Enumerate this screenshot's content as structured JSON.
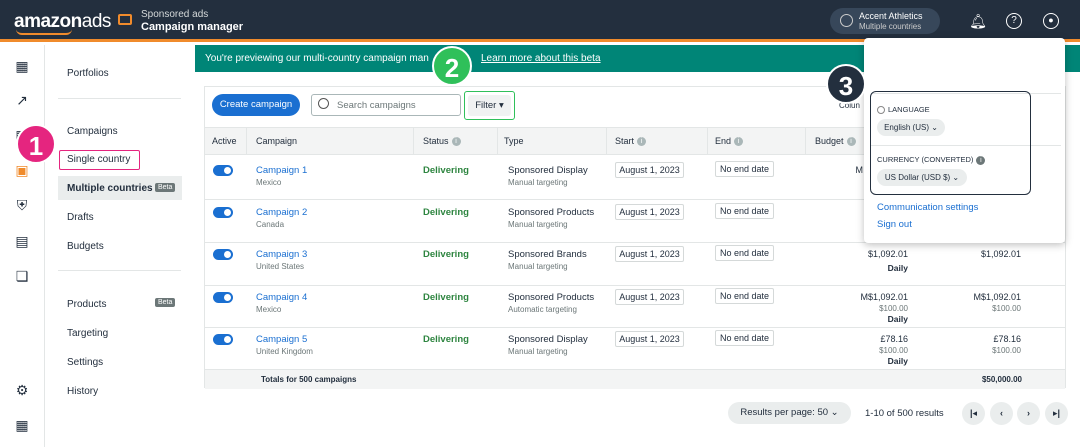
{
  "header": {
    "logo": "amazonads",
    "logo_main": "amazon",
    "logo_suffix": "ads",
    "section_sub": "Sponsored ads",
    "section_title": "Campaign manager",
    "account_name": "Accent Athletics",
    "account_sub": "Multiple countries",
    "icons": [
      "notification-bell-icon",
      "help-icon",
      "user-icon"
    ]
  },
  "rail_icons": [
    "dashboard-icon",
    "trend-icon",
    "campaigns-icon",
    "wallet-icon",
    "shield-icon",
    "bar-chart-icon",
    "media-icon",
    "settings-gear-icon",
    "apps-grid-icon"
  ],
  "nav": {
    "portfolios": "Portfolios",
    "campaigns": "Campaigns",
    "single_country": "Single country",
    "multiple_countries": "Multiple countries",
    "beta": "Beta",
    "drafts": "Drafts",
    "budgets": "Budgets",
    "products": "Products",
    "targeting": "Targeting",
    "settings": "Settings",
    "history": "History"
  },
  "banner": {
    "text": "You're previewing our multi-country campaign man",
    "link": "Learn more about this beta"
  },
  "badges": {
    "one": "1",
    "two": "2",
    "three": "3"
  },
  "toolbar": {
    "create": "Create campaign",
    "search_placeholder": "Search campaigns",
    "filter": "Filter ▾",
    "columns": "Colun"
  },
  "table": {
    "headers": {
      "active": "Active",
      "campaign": "Campaign",
      "status": "Status",
      "type": "Type",
      "start": "Start",
      "end": "End",
      "budget": "Budget"
    },
    "rows": [
      {
        "name": "Campaign 1",
        "country": "Mexico",
        "status": "Delivering",
        "type": "Sponsored Display",
        "targeting": "Manual targeting",
        "start": "August 1, 2023",
        "end": "No end date",
        "budget": "M",
        "budget_sub": "",
        "budget_daily": "",
        "budget2": "",
        "budget2_sub": ""
      },
      {
        "name": "Campaign 2",
        "country": "Canada",
        "status": "Delivering",
        "type": "Sponsored Products",
        "targeting": "Manual targeting",
        "start": "August 1, 2023",
        "end": "No end date",
        "budget": "",
        "budget_sub": "",
        "budget_daily": "",
        "budget2": "",
        "budget2_sub": ""
      },
      {
        "name": "Campaign 3",
        "country": "United States",
        "status": "Delivering",
        "type": "Sponsored Brands",
        "targeting": "Manual targeting",
        "start": "August 1, 2023",
        "end": "No end date",
        "budget": "$1,092.01",
        "budget_sub": "",
        "budget_daily": "Daily",
        "budget2": "$1,092.01",
        "budget2_sub": ""
      },
      {
        "name": "Campaign 4",
        "country": "Mexico",
        "status": "Delivering",
        "type": "Sponsored Products",
        "targeting": "Automatic targeting",
        "start": "August 1, 2023",
        "end": "No end date",
        "budget": "M$1,092.01",
        "budget_sub": "$100.00",
        "budget_daily": "Daily",
        "budget2": "M$1,092.01",
        "budget2_sub": "$100.00"
      },
      {
        "name": "Campaign 5",
        "country": "United Kingdom",
        "status": "Delivering",
        "type": "Sponsored Display",
        "targeting": "Manual targeting",
        "start": "August 1, 2023",
        "end": "No end date",
        "budget": "£78.16",
        "budget_sub": "$100.00",
        "budget_daily": "Daily",
        "budget2": "£78.16",
        "budget2_sub": "$100.00"
      }
    ],
    "totals_label": "Totals for 500 campaigns",
    "totals_value": "$50,000.00"
  },
  "pagination": {
    "per_page": "Results per page: 50  ⌄",
    "range": "1-10 of 500 results",
    "first": "|◂",
    "prev": "‹",
    "next": "›",
    "last": "▸|"
  },
  "dropdown": {
    "language_label": "LANGUAGE",
    "language_value": "English (US)  ⌄",
    "currency_label": "CURRENCY (CONVERTED)",
    "currency_value": "US Dollar (USD $)  ⌄",
    "comm_settings": "Communication settings",
    "sign_out": "Sign out"
  },
  "colors": {
    "brand_dark": "#232f3e",
    "accent_orange": "#f08b2c",
    "banner_teal": "#008577",
    "link_blue": "#1a6fd1",
    "status_green": "#2e8540",
    "badge_pink": "#e5257f",
    "badge_green": "#2fc05a",
    "badge_navy": "#232f3e"
  }
}
